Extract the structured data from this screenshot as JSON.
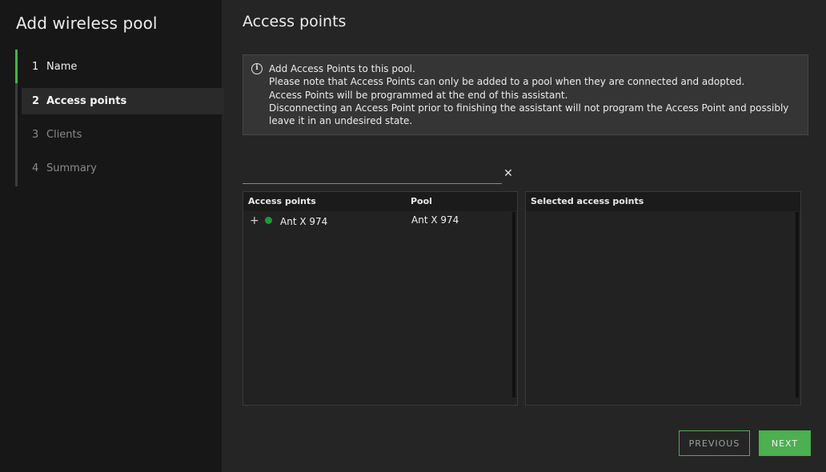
{
  "sidebar": {
    "title": "Add wireless pool",
    "steps": [
      {
        "num": "1",
        "label": "Name"
      },
      {
        "num": "2",
        "label": "Access points"
      },
      {
        "num": "3",
        "label": "Clients"
      },
      {
        "num": "4",
        "label": "Summary"
      }
    ]
  },
  "main": {
    "title": "Access points",
    "info": {
      "lines": [
        "Add Access Points to this pool.",
        "Please note that Access Points can only be added to a pool when they are connected and adopted.",
        "Access Points will be programmed at the end of this assistant.",
        "Disconnecting an Access Point prior to finishing the assistant will not program the Access Point and possibly leave it in an undesired state."
      ]
    },
    "search": {
      "value": "",
      "placeholder": ""
    },
    "available_table": {
      "columns": [
        "Access points",
        "Pool"
      ],
      "rows": [
        {
          "name": "Ant X 974",
          "pool": "Ant X 974",
          "status_color": "#1e9b2e"
        }
      ]
    },
    "selected_table": {
      "columns": [
        "Selected access points"
      ],
      "rows": []
    }
  },
  "footer": {
    "previous_label": "PREVIOUS",
    "next_label": "NEXT"
  },
  "colors": {
    "accent": "#4caf50",
    "status_online": "#1e9b2e"
  }
}
